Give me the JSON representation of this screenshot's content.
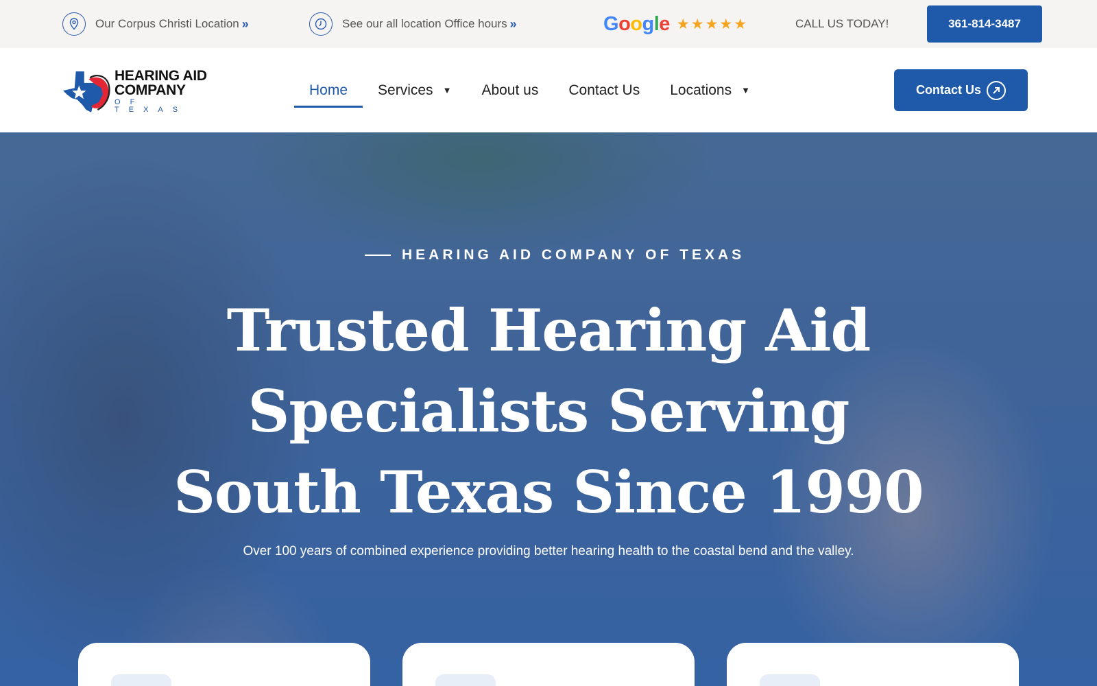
{
  "topbar": {
    "location_text": "Our Corpus Christi Location",
    "hours_text": "See our all location Office hours",
    "arrows": "»",
    "google_letters": [
      {
        "char": "G",
        "color": "#4285F4"
      },
      {
        "char": "o",
        "color": "#EA4335"
      },
      {
        "char": "o",
        "color": "#FBBC05"
      },
      {
        "char": "g",
        "color": "#4285F4"
      },
      {
        "char": "l",
        "color": "#34A853"
      },
      {
        "char": "e",
        "color": "#EA4335"
      }
    ],
    "stars": "★★★★★",
    "call_text": "CALL US TODAY!",
    "phone": "361-814-3487"
  },
  "header": {
    "logo_line1": "HEARING AID",
    "logo_line2": "COMPANY",
    "logo_line3": "OF TEXAS",
    "nav": [
      {
        "label": "Home",
        "active": true,
        "dropdown": false
      },
      {
        "label": "Services",
        "active": false,
        "dropdown": true
      },
      {
        "label": "About us",
        "active": false,
        "dropdown": false
      },
      {
        "label": "Contact Us",
        "active": false,
        "dropdown": false
      },
      {
        "label": "Locations",
        "active": false,
        "dropdown": true
      }
    ],
    "cta_label": "Contact Us"
  },
  "hero": {
    "eyebrow": "HEARING AID COMPANY OF TEXAS",
    "title_lines": [
      "Trusted Hearing Aid",
      "Specialists Serving",
      "South Texas Since 1990"
    ],
    "subtitle": "Over 100 years of combined experience providing better hearing health to the coastal bend and the valley."
  },
  "colors": {
    "brand_blue": "#1f59a9",
    "star_gold": "#f3a521",
    "topbar_bg": "#f5f4f2"
  },
  "icons": {
    "location": "map-pin-icon",
    "hours": "clock-icon",
    "cta": "arrow-up-right-icon",
    "caret": "caret-down-icon"
  }
}
